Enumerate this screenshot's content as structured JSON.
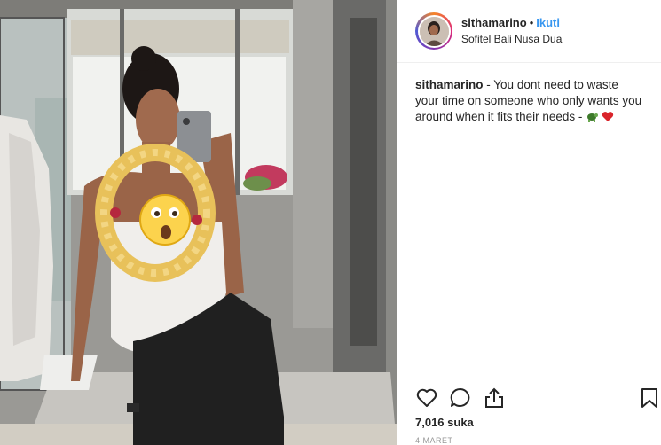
{
  "header": {
    "username": "sithamarino",
    "separator": "•",
    "follow_label": "Ikuti",
    "location": "Sofitel Bali Nusa Dua"
  },
  "caption": {
    "username": "sithamarino",
    "text": " - You dont need to waste your time on someone who only wants you around when it fits their needs - "
  },
  "actions": {
    "icons": [
      "heart-icon",
      "comment-icon",
      "share-icon",
      "bookmark-icon"
    ]
  },
  "likes": "7,016 suka",
  "date": "4 MARET",
  "colors": {
    "follow": "#3897f0",
    "text": "#262626",
    "muted": "#999999"
  }
}
